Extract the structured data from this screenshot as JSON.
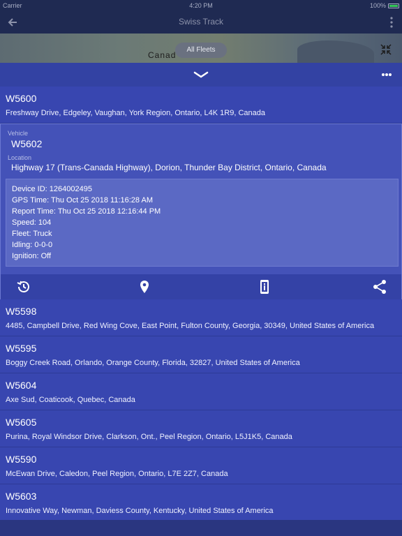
{
  "status_bar": {
    "carrier": "Carrier",
    "time": "4:20 PM",
    "battery": "100%"
  },
  "nav": {
    "title": "Swiss Track",
    "back_icon": "arrow-left-icon",
    "more_icon": "vertical-dots-icon"
  },
  "map": {
    "country_label": "Canad",
    "fleet_filter": "All Fleets",
    "expand_icon": "collapse-arrows-icon"
  },
  "sheet": {
    "collapse_icon": "chevron-down-icon",
    "menu_icon": "horizontal-dots-icon"
  },
  "vehicles_before": [
    {
      "name": "W5600",
      "address": "Freshway Drive, Edgeley, Vaughan, York Region, Ontario, L4K 1R9, Canada"
    }
  ],
  "selected": {
    "vehicle_label": "Vehicle",
    "vehicle": "W5602",
    "location_label": "Location",
    "location": "Highway 17 (Trans-Canada Highway), Dorion, Thunder Bay District, Ontario, Canada",
    "details": [
      "Device ID: 1264002495",
      "GPS Time: Thu Oct 25 2018 11:16:28 AM",
      "Report Time: Thu Oct 25 2018 12:16:44 PM",
      "Speed: 104",
      "Fleet: Truck",
      "Idling: 0-0-0",
      "Ignition: Off"
    ],
    "actions": [
      "history-icon",
      "location-pin-icon",
      "device-info-icon",
      "share-icon"
    ]
  },
  "vehicles_after": [
    {
      "name": "W5598",
      "address": "4485, Campbell Drive, Red Wing Cove, East Point, Fulton County, Georgia, 30349, United States of America"
    },
    {
      "name": "W5595",
      "address": "Boggy Creek Road, Orlando, Orange County, Florida, 32827, United States of America"
    },
    {
      "name": "W5604",
      "address": "Axe Sud, Coaticook, Quebec, Canada"
    },
    {
      "name": "W5605",
      "address": "Purina, Royal Windsor Drive, Clarkson, Ont., Peel Region, Ontario, L5J1K5, Canada"
    },
    {
      "name": "W5590",
      "address": "McEwan Drive, Caledon, Peel Region, Ontario, L7E 2Z7, Canada"
    },
    {
      "name": "W5603",
      "address": "Innovative Way, Newman, Daviess County, Kentucky, United States of America"
    }
  ],
  "colors": {
    "accent": "#3846b0",
    "selected": "#4452b8",
    "detail_panel": "#5b69c4",
    "nav": "#1f2a52"
  }
}
